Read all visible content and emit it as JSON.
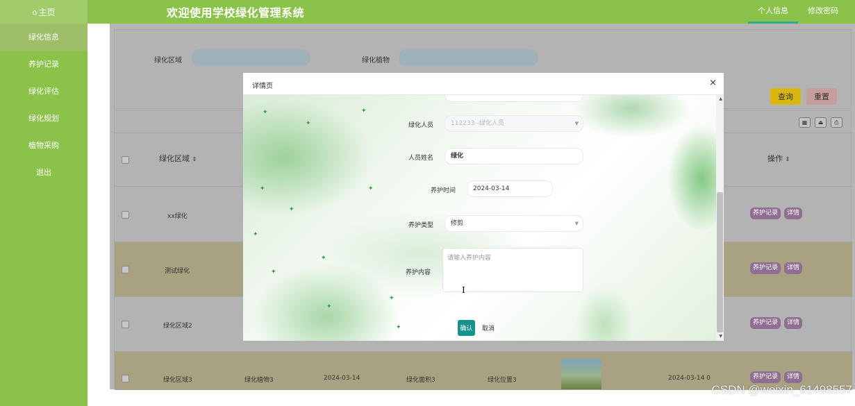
{
  "header": {
    "home": "主页",
    "title": "欢迎使用学校绿化管理系统",
    "nav": [
      "个人信息",
      "修改密码"
    ]
  },
  "sidebar": {
    "items": [
      "绿化信息",
      "养护记录",
      "绿化评估",
      "绿化规划",
      "植物采购",
      "退出"
    ]
  },
  "search": {
    "label_area": "绿化区域",
    "label_plant": "绿化植物",
    "query_button": "查询",
    "reset_button": "重置"
  },
  "table": {
    "headers": [
      "绿化区域",
      "操作"
    ],
    "rows": [
      {
        "area": "xx绿化"
      },
      {
        "area": "测试绿化"
      },
      {
        "area": "绿化区域2"
      },
      {
        "area": "绿化区域3",
        "plant": "绿化植物3",
        "date": "2024-03-14",
        "size": "绿化面积3",
        "location": "绿化位置3",
        "time": "2024-03-14 0"
      }
    ],
    "action_record": "养护记录",
    "action_detail": "详情"
  },
  "modal": {
    "title": "详情页",
    "close": "×",
    "fields": {
      "staff_label": "绿化人员",
      "staff_value": "112233--绿化人员",
      "name_label": "人员姓名",
      "name_value": "绿化",
      "time_label": "养护时间",
      "time_value": "2024-03-14",
      "type_label": "养护类型",
      "type_value": "修剪",
      "content_label": "养护内容",
      "content_placeholder": "请输入养护内容"
    },
    "confirm": "确认",
    "cancel": "取消"
  },
  "watermark": "CSDN @weixin_61498557"
}
